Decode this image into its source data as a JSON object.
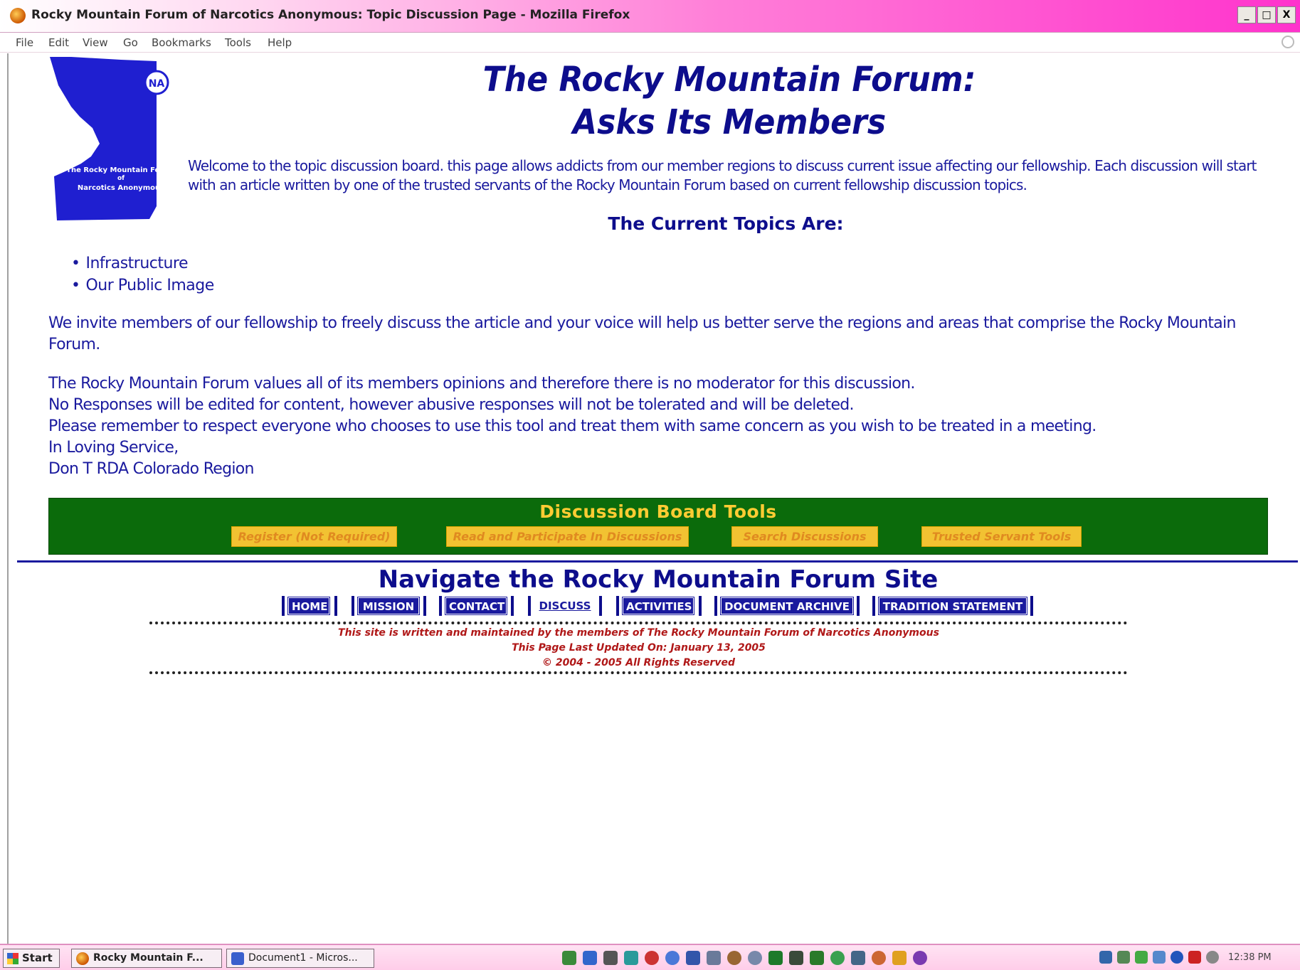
{
  "window": {
    "title": "Rocky Mountain Forum of Narcotics Anonymous: Topic Discussion Page - Mozilla Firefox",
    "controls": [
      "_",
      "□",
      "X"
    ]
  },
  "menubar": {
    "items": [
      "File",
      "Edit",
      "View",
      "Go",
      "Bookmarks",
      "Tools",
      "Help"
    ]
  },
  "logo": {
    "text_line1": "The Rocky Mountain Forum",
    "text_line2": "of",
    "text_line3": "Narcotics Anonymous",
    "emblem": "NA"
  },
  "page": {
    "title_line1": "The Rocky Mountain Forum:",
    "title_line2": "Asks Its Members",
    "intro": "Welcome to the topic discussion board. this page allows addicts from our member regions to discuss current issue affecting our fellowship. Each discussion will start with an article written by one of the trusted servants of the Rocky Mountain Forum based on current fellowship discussion topics.",
    "topics_heading": "The Current Topics Are:",
    "topics": [
      "Infrastructure",
      "Our Public Image"
    ],
    "invite": "We invite members of our fellowship to freely discuss the article and your voice will help us better serve the regions and areas that comprise the Rocky Mountain Forum.",
    "values_lines": [
      "The Rocky Mountain Forum values all of its members opinions and therefore there is no moderator for this discussion.",
      "No Responses will be edited for content, however abusive responses will not be tolerated and will be deleted.",
      "Please remember to respect everyone who chooses to use this tool and treat them with same concern as you wish to be treated in a meeting.",
      "In Loving Service,",
      "Don T RDA Colorado Region"
    ]
  },
  "tools": {
    "heading": "Discussion Board Tools",
    "buttons": [
      "Register (Not Required)",
      "Read and Participate In Discussions",
      "Search Discussions",
      "Trusted Servant Tools"
    ]
  },
  "nav": {
    "heading": "Navigate the Rocky Mountain Forum Site",
    "links": [
      "HOME",
      "MISSION",
      "CONTACT",
      "DISCUSS",
      "ACTIVITIES",
      "DOCUMENT ARCHIVE",
      "TRADITION STATEMENT"
    ]
  },
  "footer": {
    "line1": "This site is written and maintained by the members of The Rocky Mountain Forum of Narcotics Anonymous",
    "line2": "This Page Last Updated On: January 13, 2005",
    "line3": "© 2004 - 2005 All Rights Reserved"
  },
  "taskbar": {
    "start": "Start",
    "tasks": [
      "Rocky Mountain F...",
      "Document1 - Micros..."
    ],
    "clock": "12:38 PM"
  },
  "colors": {
    "heading_blue": "#0d0d8c",
    "text_blue": "#1a1a9e",
    "tools_green": "#0b6b0b",
    "tools_gold": "#ffcc33",
    "footer_red": "#b01818"
  }
}
